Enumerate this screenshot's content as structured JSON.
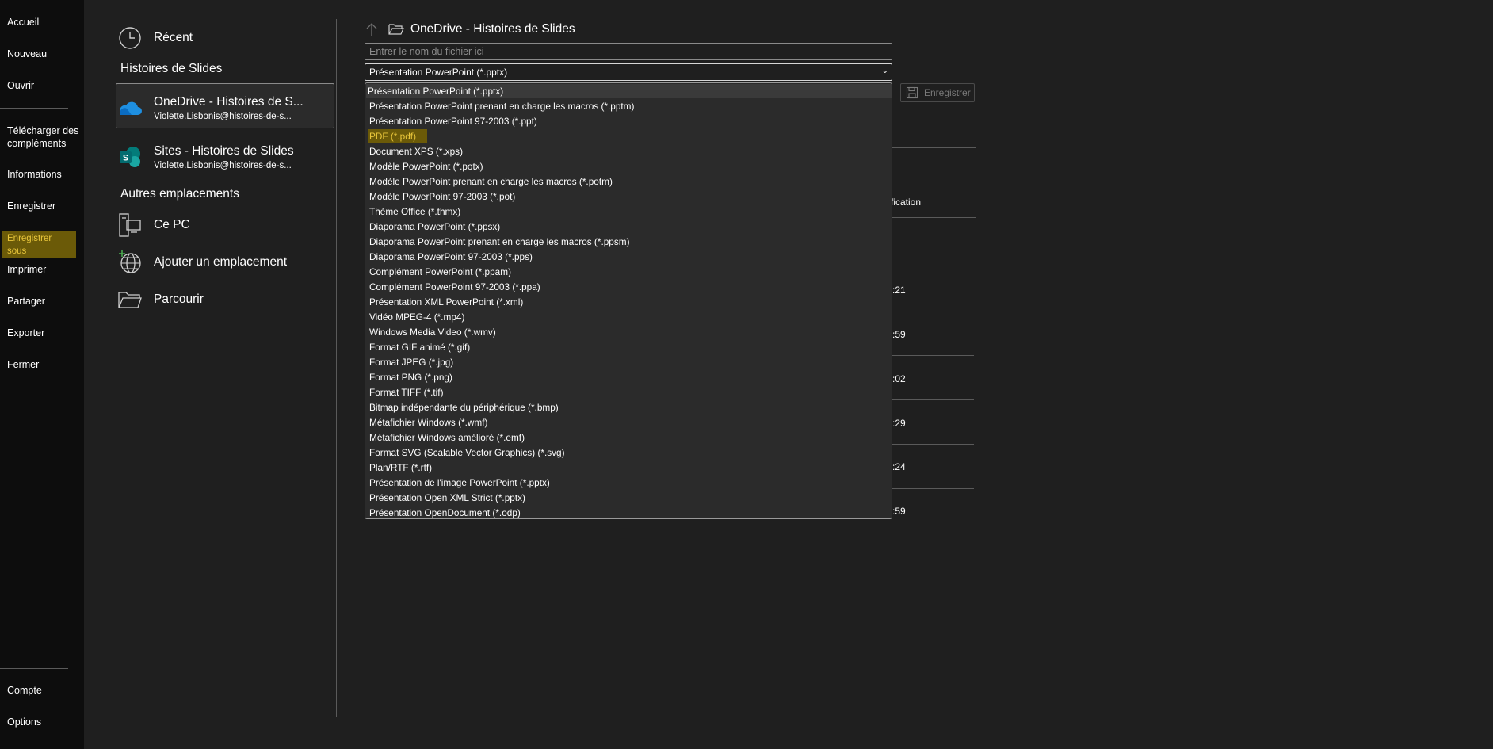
{
  "nav": {
    "items": [
      "Accueil",
      "Nouveau",
      "Ouvrir",
      "Télécharger des compléments",
      "Informations",
      "Enregistrer",
      "Enregistrer sous",
      "Imprimer",
      "Partager",
      "Exporter",
      "Fermer"
    ],
    "bottom": [
      "Compte",
      "Options"
    ],
    "active": "Enregistrer sous"
  },
  "locations": {
    "recent": "Récent",
    "section_org": "Histoires de Slides",
    "onedrive": {
      "title": "OneDrive - Histoires de S...",
      "sub": "Violette.Lisbonis@histoires-de-s..."
    },
    "sites": {
      "title": "Sites - Histoires de Slides",
      "sub": "Violette.Lisbonis@histoires-de-s..."
    },
    "section_other": "Autres emplacements",
    "this_pc": "Ce PC",
    "add_place": "Ajouter un emplacement",
    "browse": "Parcourir"
  },
  "save": {
    "path": "OneDrive - Histoires de Slides",
    "filename_placeholder": "Entrer le nom du fichier ici",
    "filetype_selected": "Présentation PowerPoint (*.pptx)",
    "save_label": "Enregistrer",
    "column_header_fragment": "fication",
    "time_fragments": [
      ":21",
      ":59",
      ":02",
      ":29",
      ":24",
      ":59"
    ]
  },
  "dropdown": {
    "highlighted": "PDF (*.pdf)",
    "options": [
      "Présentation PowerPoint (*.pptx)",
      "Présentation PowerPoint prenant en charge les macros (*.pptm)",
      "Présentation PowerPoint 97-2003 (*.ppt)",
      "PDF (*.pdf)",
      "Document XPS (*.xps)",
      "Modèle PowerPoint (*.potx)",
      "Modèle PowerPoint prenant en charge les macros (*.potm)",
      "Modèle PowerPoint 97-2003 (*.pot)",
      "Thème Office (*.thmx)",
      "Diaporama PowerPoint (*.ppsx)",
      "Diaporama PowerPoint prenant en charge les macros (*.ppsm)",
      "Diaporama PowerPoint 97-2003 (*.pps)",
      "Complément PowerPoint (*.ppam)",
      "Complément PowerPoint 97-2003 (*.ppa)",
      "Présentation XML PowerPoint (*.xml)",
      "Vidéo MPEG-4 (*.mp4)",
      "Windows Media Video (*.wmv)",
      "Format GIF animé (*.gif)",
      "Format JPEG (*.jpg)",
      "Format PNG (*.png)",
      "Format TIFF (*.tif)",
      "Bitmap indépendante du périphérique (*.bmp)",
      "Métafichier Windows (*.wmf)",
      "Métafichier Windows amélioré (*.emf)",
      "Format SVG (Scalable Vector Graphics) (*.svg)",
      "Plan/RTF (*.rtf)",
      "Présentation de l'image PowerPoint  (*.pptx)",
      "Présentation Open XML Strict (*.pptx)",
      "Présentation OpenDocument  (*.odp)"
    ]
  },
  "colors": {
    "accent_highlight": "#6b5a08",
    "accent_text": "#e8c53a",
    "background": "#1f1f1f",
    "nav_background": "#0d0d0d"
  }
}
